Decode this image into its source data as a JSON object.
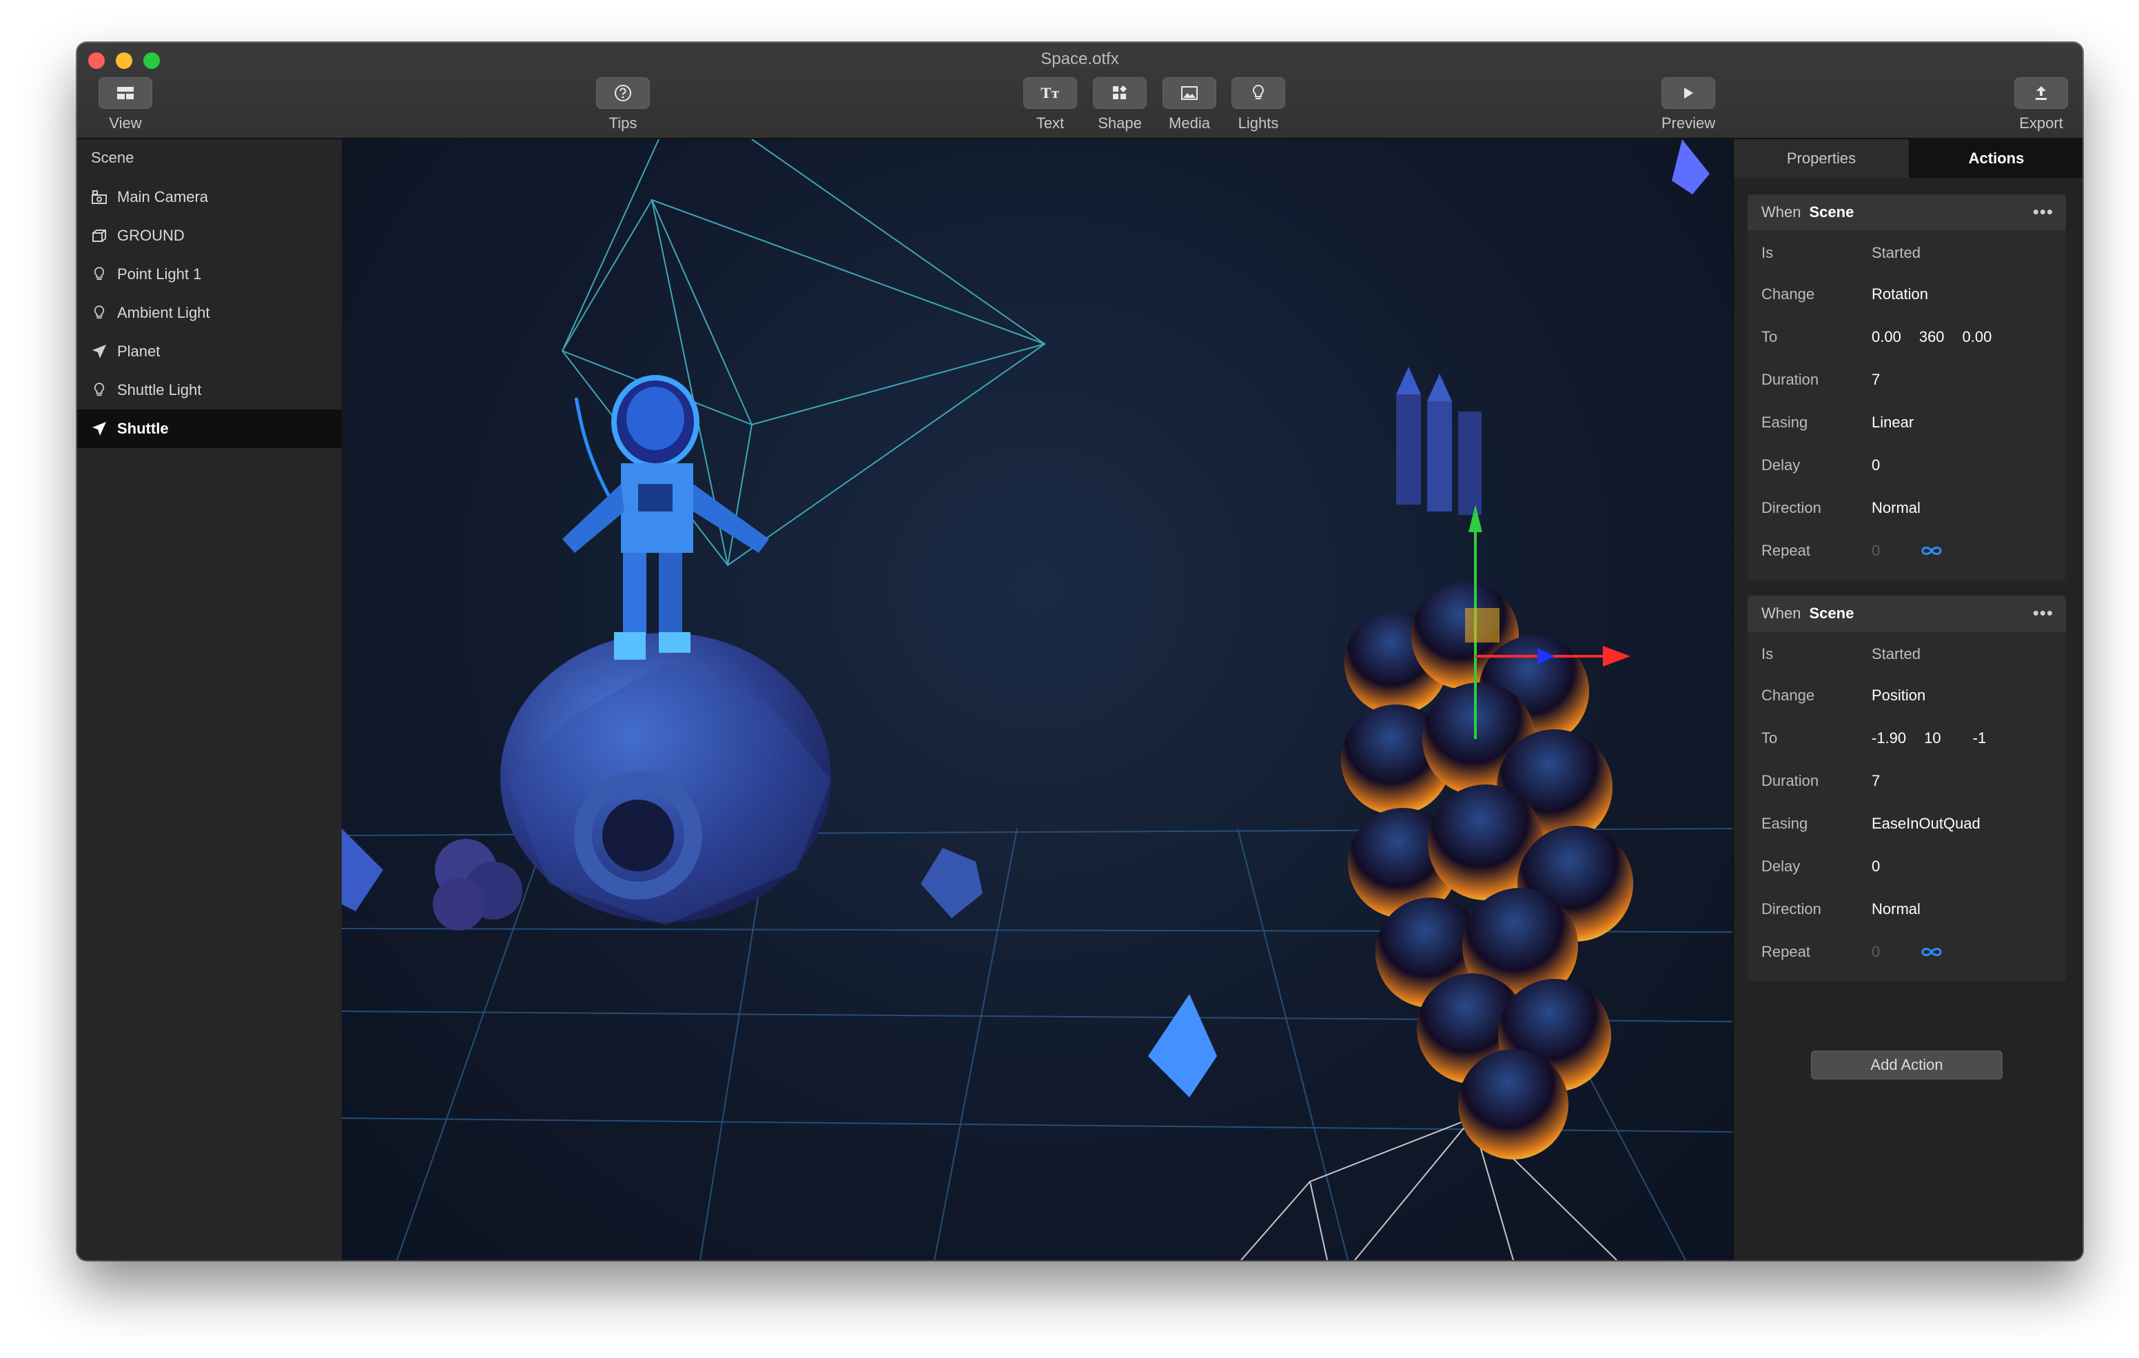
{
  "window": {
    "title": "Space.otfx"
  },
  "toolbar": {
    "view": {
      "label": "View",
      "icon": "sidebar-layout-icon"
    },
    "tips": {
      "label": "Tips",
      "icon": "help-circle-icon"
    },
    "text": {
      "label": "Text",
      "icon": "text-format-icon",
      "glyph": "Tт"
    },
    "shape": {
      "label": "Shape",
      "icon": "shapes-grid-icon"
    },
    "media": {
      "label": "Media",
      "icon": "image-icon"
    },
    "lights": {
      "label": "Lights",
      "icon": "lightbulb-icon"
    },
    "preview": {
      "label": "Preview",
      "icon": "play-icon"
    },
    "export": {
      "label": "Export",
      "icon": "upload-icon"
    }
  },
  "sidebar": {
    "header": "Scene",
    "items": [
      {
        "label": "Main Camera",
        "icon": "camera-icon"
      },
      {
        "label": "GROUND",
        "icon": "cube-icon"
      },
      {
        "label": "Point Light 1",
        "icon": "lightbulb-icon"
      },
      {
        "label": "Ambient Light",
        "icon": "lightbulb-icon"
      },
      {
        "label": "Planet",
        "icon": "paper-plane-icon"
      },
      {
        "label": "Shuttle Light",
        "icon": "lightbulb-icon"
      },
      {
        "label": "Shuttle",
        "icon": "paper-plane-icon",
        "selected": true
      }
    ]
  },
  "panel": {
    "tabs": {
      "properties": "Properties",
      "actions": "Actions"
    },
    "actions": [
      {
        "when_label": "When",
        "when_value": "Scene",
        "is_label": "Is",
        "is_value": "Started",
        "change_label": "Change",
        "change_value": "Rotation",
        "to_label": "To",
        "to_values": [
          "0.00",
          "360",
          "0.00"
        ],
        "duration_label": "Duration",
        "duration_value": "7",
        "easing_label": "Easing",
        "easing_value": "Linear",
        "delay_label": "Delay",
        "delay_value": "0",
        "direction_label": "Direction",
        "direction_value": "Normal",
        "repeat_label": "Repeat",
        "repeat_value": "0"
      },
      {
        "when_label": "When",
        "when_value": "Scene",
        "is_label": "Is",
        "is_value": "Started",
        "change_label": "Change",
        "change_value": "Position",
        "to_label": "To",
        "to_values": [
          "-1.90",
          "10",
          "-1"
        ],
        "duration_label": "Duration",
        "duration_value": "7",
        "easing_label": "Easing",
        "easing_value": "EaseInOutQuad",
        "delay_label": "Delay",
        "delay_value": "0",
        "direction_label": "Direction",
        "direction_value": "Normal",
        "repeat_label": "Repeat",
        "repeat_value": "0"
      }
    ],
    "add_action": "Add Action",
    "more_glyph": "•••"
  },
  "colors": {
    "accent_blue": "#2f8cff",
    "traffic_red": "#fe5f57",
    "traffic_yellow": "#febc2e",
    "traffic_green": "#28c840"
  }
}
